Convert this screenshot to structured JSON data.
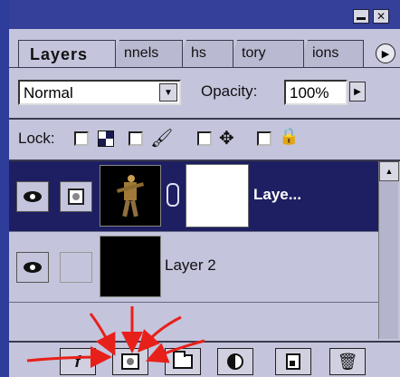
{
  "panel": {
    "tabs": [
      {
        "label": "Layers",
        "active": true
      },
      {
        "label": "nnels"
      },
      {
        "label": "hs"
      },
      {
        "label": "tory"
      },
      {
        "label": "ions"
      }
    ]
  },
  "blend": {
    "mode": "Normal",
    "opacity_label": "Opacity:",
    "opacity_value": "100%"
  },
  "lock": {
    "label": "Lock:"
  },
  "layers": [
    {
      "name": "Laye...",
      "selected": true,
      "has_mask": true,
      "visible": true
    },
    {
      "name": "Layer 2",
      "selected": false,
      "has_mask": false,
      "visible": true
    }
  ],
  "icons": {
    "panel_menu": "panel-menu-arrow-icon",
    "eye": "eye-icon",
    "chain": "chain-link-icon"
  },
  "colors": {
    "title_bar": "#34409a",
    "panel_bg": "#c4c4dc",
    "selection": "#1e1e62",
    "annotation_arrows": "#e8201a"
  }
}
